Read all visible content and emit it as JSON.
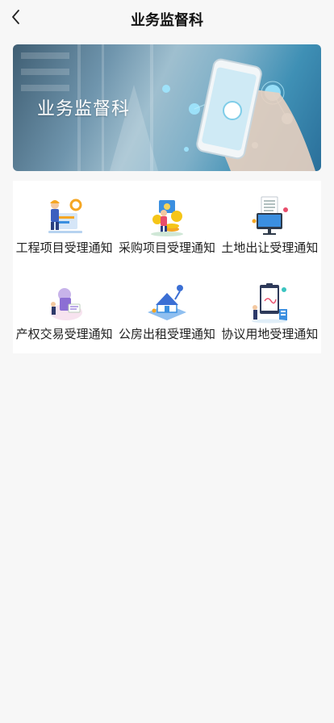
{
  "header": {
    "title": "业务监督科"
  },
  "banner": {
    "text": "业务监督科"
  },
  "grid": {
    "items": [
      {
        "label": "工程项目受理通知",
        "icon": "engineering-worker-icon"
      },
      {
        "label": "采购项目受理通知",
        "icon": "procurement-coins-icon"
      },
      {
        "label": "土地出让受理通知",
        "icon": "land-transfer-monitor-icon"
      },
      {
        "label": "产权交易受理通知",
        "icon": "property-rights-trade-icon"
      },
      {
        "label": "公房出租受理通知",
        "icon": "public-housing-rental-icon"
      },
      {
        "label": "协议用地受理通知",
        "icon": "agreement-land-document-icon"
      }
    ]
  },
  "colors": {
    "background": "#f7f7f7",
    "card": "#ffffff",
    "text": "#222222",
    "accent_blue": "#3b8fe0",
    "accent_orange": "#f5a623"
  }
}
